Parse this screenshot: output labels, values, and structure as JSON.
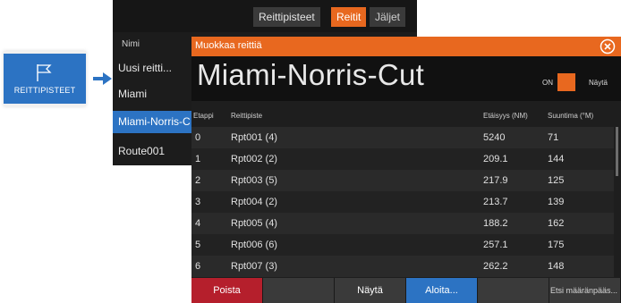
{
  "launcher": {
    "label": "REITTIPISTEET",
    "icon": "flag-icon"
  },
  "list_panel": {
    "tabs": [
      "Reittipisteet",
      "Reitit",
      "Jäljet"
    ],
    "column_header": "Nimi",
    "items": [
      "Uusi reitti...",
      "Miami",
      "Miami-Norris-C",
      "Route001"
    ]
  },
  "dialog": {
    "title": "Muokkaa reittiä",
    "route_name": "Miami-Norris-Cut",
    "toggle_state": "ON",
    "toggle_label": "Näytä",
    "columns": [
      "Etappi",
      "Reittipiste",
      "Etäisyys (NM)",
      "Suuntima (°M)"
    ],
    "rows": [
      [
        "0",
        "Rpt001 (4)",
        "5240",
        "71"
      ],
      [
        "1",
        "Rpt002 (2)",
        "209.1",
        "144"
      ],
      [
        "2",
        "Rpt003 (5)",
        "217.9",
        "125"
      ],
      [
        "3",
        "Rpt004 (2)",
        "213.7",
        "139"
      ],
      [
        "4",
        "Rpt005 (4)",
        "188.2",
        "162"
      ],
      [
        "5",
        "Rpt006 (6)",
        "257.1",
        "175"
      ],
      [
        "6",
        "Rpt007 (3)",
        "262.2",
        "148"
      ]
    ],
    "buttons": {
      "delete": "Poista",
      "show": "Näytä",
      "start": "Aloita...",
      "search": "Etsi määränpääs..."
    }
  },
  "colors": {
    "accent": "#e8681f",
    "selection": "#2c73c3",
    "delete": "#b51f2c"
  }
}
